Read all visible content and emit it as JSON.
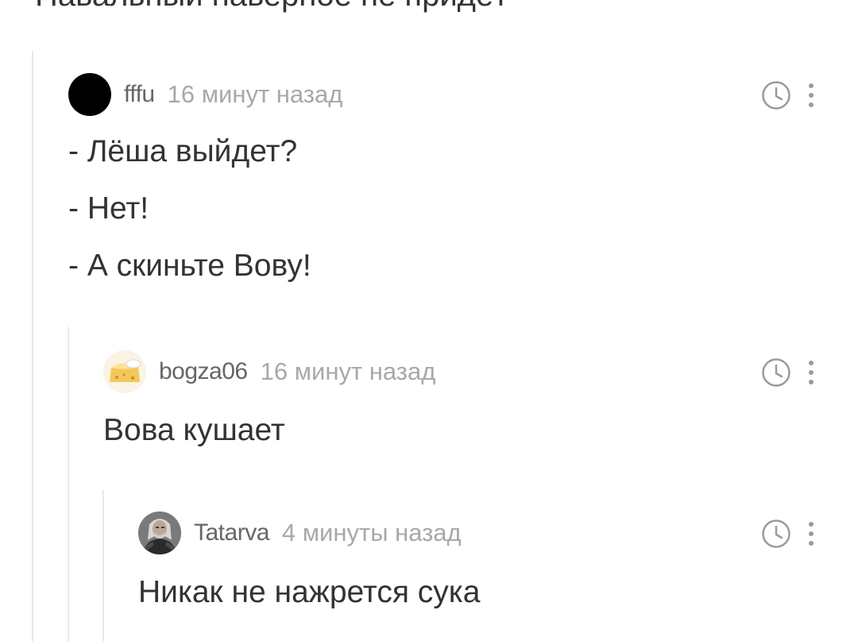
{
  "previous_text": "Навальный наверное не придёт",
  "comments": [
    {
      "username": "fffu",
      "timestamp": "16 минут назад",
      "avatar": "black-circle-avatar",
      "lines": [
        "- Лёша выйдет?",
        "- Нет!",
        "- А скиньте Вову!"
      ]
    },
    {
      "username": "bogza06",
      "timestamp": "16 минут назад",
      "avatar": "cheese-avatar",
      "lines": [
        "Вова кушает"
      ]
    },
    {
      "username": "Tatarva",
      "timestamp": "4 минуты назад",
      "avatar": "witcher-portrait-avatar",
      "lines": [
        "Никак не нажрется сука"
      ]
    }
  ],
  "icons": {
    "clock": "clock-icon",
    "more": "more-vertical-icon"
  },
  "colors": {
    "text": "#333333",
    "meta": "#a8a8a8",
    "username": "#666666",
    "thread_line": "#e8e8e8",
    "icon": "#9a9a9a"
  }
}
